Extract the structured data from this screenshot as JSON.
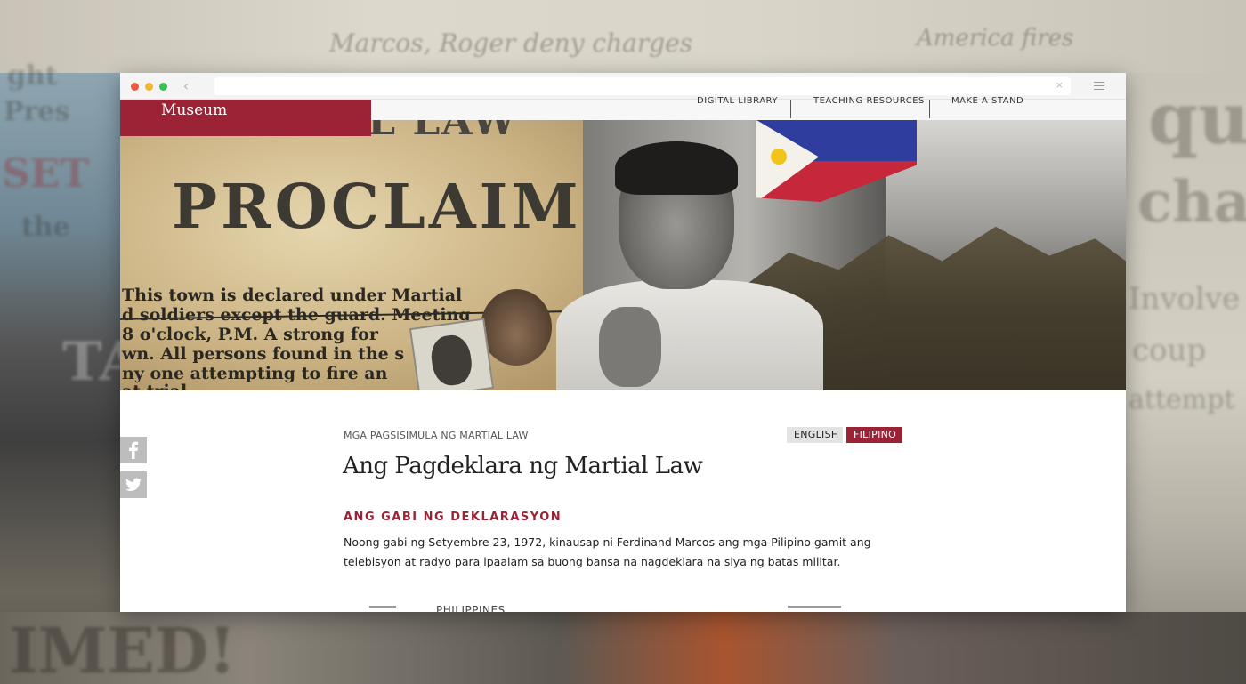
{
  "background": {
    "headlines": [
      "Marcos, Roger deny charges",
      "America fires"
    ],
    "words": [
      "ght",
      "Pres",
      "SET",
      "the",
      "TA",
      "IMED!",
      "Involve",
      "coup",
      "attempt",
      "cha",
      "qu"
    ]
  },
  "browser": {
    "url": "",
    "close_glyph": "×",
    "back_glyph": "‹"
  },
  "site": {
    "logo_text": "Museum",
    "nav": [
      "DIGITAL LIBRARY",
      "TEACHING RESOURCES",
      "MAKE A STAND"
    ]
  },
  "hero": {
    "headline_top": "MARTIAL LAW",
    "headline": "PROCLAIMED!",
    "lines": [
      "This town is declared under Martial",
      "d soldiers except the guard. Meeting",
      "8 o'clock, P.M. A strong for",
      "wn.  All persons found in the s",
      "ny one  attempting to fire an",
      "at trial"
    ]
  },
  "share": {
    "facebook_icon": "facebook-icon",
    "twitter_icon": "twitter-icon"
  },
  "article": {
    "breadcrumb": "MGA PAGSISIMULA NG MARTIAL LAW",
    "lang_english": "ENGLISH",
    "lang_filipino": "FILIPINO",
    "title": "Ang Pagdeklara ng Martial Law",
    "section_heading": "ANG GABI NG DEKLARASYON",
    "body": "Noong gabi ng Setyembre 23, 1972, kinausap ni Ferdinand Marcos ang mga Pilipino gamit ang telebisyon at radyo para ipaalam sa buong bansa na nagdeklara na siya ng batas militar.",
    "next_image_caption": "PHILIPPINES"
  },
  "colors": {
    "brand": "#9b2335",
    "lang_inactive": "#e3e3e3",
    "share_bg": "#bdbdbd"
  }
}
